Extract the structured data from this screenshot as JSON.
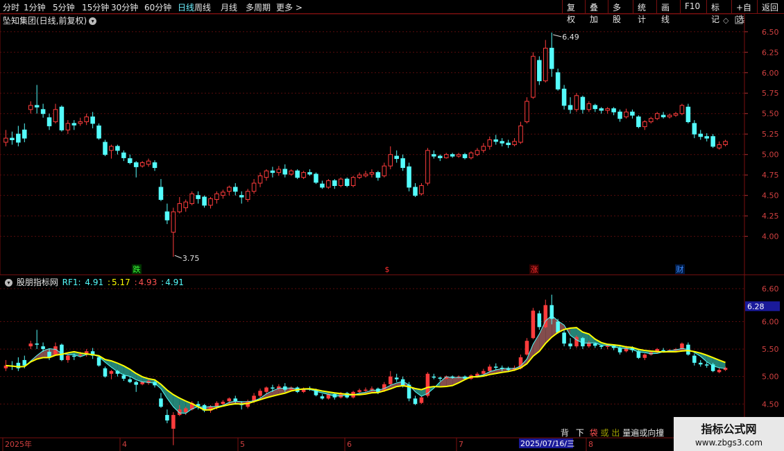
{
  "toolbar": {
    "periods": [
      "分时",
      "1分钟",
      "5分钟",
      "15分钟",
      "30分钟",
      "60分钟",
      "日线",
      "周线",
      "月线",
      "多周期",
      "更多 >"
    ],
    "active_period": "日线",
    "right_buttons": [
      "复权",
      "叠加",
      "多股",
      "统计",
      "画线",
      "F10",
      "标记",
      "+自选",
      "返回"
    ]
  },
  "main_title": "坠知集团(日线,前复权)",
  "price_axis": [
    "6.50",
    "6.25",
    "6.00",
    "5.75",
    "5.50",
    "5.25",
    "5.00",
    "4.75",
    "4.50",
    "4.25",
    "4.00"
  ],
  "high_label": "6.49",
  "low_label": "3.75",
  "event_markers": [
    "跌",
    "$",
    "涨",
    "财"
  ],
  "indicator": {
    "name": "股朋指标网",
    "rf1_label": "RF1:",
    "values": [
      "4.91",
      "5.17",
      "4.93",
      "4.91"
    ],
    "axis": [
      "6.60",
      "6.00",
      "5.50",
      "5.00",
      "4.50"
    ],
    "current_price_tag": "6.28"
  },
  "date_axis": {
    "labels": [
      "2025年",
      "4",
      "5",
      "6",
      "7",
      "8"
    ],
    "cursor_date": "2025/07/16/三"
  },
  "bottom_annotations": [
    "背",
    "下",
    "袋",
    "或",
    "出"
  ],
  "overlap_text": "量遍或向撞",
  "watermark": {
    "line1": "指标公式网",
    "line2": "www.zbgs3.com"
  },
  "colors": {
    "up": "#ff3c3c",
    "down": "#54fcfc",
    "grid": "#5a0c0c",
    "ma": "#ffff00",
    "cloud": "#2a9a8a",
    "cloud_red": "#9a5a5a"
  },
  "chart_data": {
    "type": "candlestick",
    "ylim": [
      3.7,
      6.6
    ],
    "candles": [
      [
        5.15,
        5.2,
        5.1,
        5.3
      ],
      [
        5.2,
        5.18,
        5.12,
        5.28
      ],
      [
        5.25,
        5.15,
        5.1,
        5.35
      ],
      [
        5.3,
        5.2,
        5.15,
        5.38
      ],
      [
        5.55,
        5.6,
        5.5,
        5.65
      ],
      [
        5.6,
        5.58,
        5.5,
        5.85
      ],
      [
        5.55,
        5.5,
        5.45,
        5.62
      ],
      [
        5.45,
        5.35,
        5.3,
        5.5
      ],
      [
        5.4,
        5.55,
        5.38,
        5.62
      ],
      [
        5.58,
        5.3,
        5.28,
        5.6
      ],
      [
        5.3,
        5.38,
        5.25,
        5.42
      ],
      [
        5.38,
        5.36,
        5.3,
        5.42
      ],
      [
        5.38,
        5.4,
        5.35,
        5.45
      ],
      [
        5.4,
        5.46,
        5.36,
        5.5
      ],
      [
        5.46,
        5.38,
        5.32,
        5.52
      ],
      [
        5.35,
        5.2,
        5.18,
        5.38
      ],
      [
        5.15,
        5.0,
        4.98,
        5.18
      ],
      [
        5.05,
        5.1,
        4.95,
        5.12
      ],
      [
        5.1,
        5.05,
        5.0,
        5.12
      ],
      [
        5.02,
        4.96,
        4.92,
        5.05
      ],
      [
        4.95,
        4.9,
        4.88,
        5.0
      ],
      [
        4.9,
        4.85,
        4.72,
        4.92
      ],
      [
        4.86,
        4.9,
        4.84,
        4.92
      ],
      [
        4.88,
        4.92,
        4.85,
        4.95
      ],
      [
        4.9,
        4.84,
        4.8,
        4.93
      ],
      [
        4.6,
        4.45,
        4.43,
        4.7
      ],
      [
        4.3,
        4.2,
        4.15,
        4.4
      ],
      [
        4.05,
        4.3,
        3.75,
        4.35
      ],
      [
        4.3,
        4.4,
        4.28,
        4.48
      ],
      [
        4.35,
        4.42,
        4.3,
        4.45
      ],
      [
        4.4,
        4.52,
        4.38,
        4.55
      ],
      [
        4.5,
        4.46,
        4.4,
        4.55
      ],
      [
        4.48,
        4.38,
        4.35,
        4.5
      ],
      [
        4.38,
        4.46,
        4.34,
        4.48
      ],
      [
        4.45,
        4.52,
        4.4,
        4.55
      ],
      [
        4.5,
        4.54,
        4.46,
        4.57
      ],
      [
        4.55,
        4.6,
        4.5,
        4.62
      ],
      [
        4.6,
        4.55,
        4.5,
        4.65
      ],
      [
        4.5,
        4.48,
        4.4,
        4.55
      ],
      [
        4.45,
        4.55,
        4.42,
        4.58
      ],
      [
        4.55,
        4.65,
        4.52,
        4.7
      ],
      [
        4.65,
        4.74,
        4.6,
        4.78
      ],
      [
        4.72,
        4.8,
        4.68,
        4.82
      ],
      [
        4.8,
        4.78,
        4.72,
        4.85
      ],
      [
        4.78,
        4.82,
        4.74,
        4.86
      ],
      [
        4.82,
        4.76,
        4.72,
        4.88
      ],
      [
        4.76,
        4.8,
        4.74,
        4.82
      ],
      [
        4.8,
        4.72,
        4.7,
        4.82
      ],
      [
        4.72,
        4.78,
        4.7,
        4.8
      ],
      [
        4.78,
        4.76,
        4.74,
        4.82
      ],
      [
        4.76,
        4.66,
        4.64,
        4.78
      ],
      [
        4.64,
        4.6,
        4.58,
        4.68
      ],
      [
        4.6,
        4.68,
        4.58,
        4.7
      ],
      [
        4.68,
        4.62,
        4.58,
        4.7
      ],
      [
        4.62,
        4.7,
        4.6,
        4.72
      ],
      [
        4.7,
        4.62,
        4.6,
        4.72
      ],
      [
        4.62,
        4.72,
        4.6,
        4.74
      ],
      [
        4.72,
        4.75,
        4.7,
        4.78
      ],
      [
        4.74,
        4.76,
        4.72,
        4.8
      ],
      [
        4.76,
        4.78,
        4.72,
        4.82
      ],
      [
        4.78,
        4.72,
        4.68,
        4.8
      ],
      [
        4.74,
        4.86,
        4.72,
        4.9
      ],
      [
        4.86,
        5.0,
        4.82,
        5.1
      ],
      [
        4.98,
        4.95,
        4.9,
        5.05
      ],
      [
        4.95,
        4.84,
        4.8,
        5.0
      ],
      [
        4.85,
        4.6,
        4.55,
        4.9
      ],
      [
        4.6,
        4.5,
        4.48,
        4.65
      ],
      [
        4.52,
        4.62,
        4.5,
        4.65
      ],
      [
        4.65,
        5.05,
        4.62,
        5.08
      ],
      [
        5.0,
        4.98,
        4.95,
        5.05
      ],
      [
        4.98,
        4.96,
        4.92,
        5.0
      ],
      [
        4.96,
        5.0,
        4.95,
        5.02
      ],
      [
        5.0,
        4.98,
        4.96,
        5.02
      ],
      [
        4.98,
        5.0,
        4.96,
        5.02
      ],
      [
        5.0,
        4.96,
        4.94,
        5.02
      ],
      [
        4.96,
        5.02,
        4.94,
        5.04
      ],
      [
        5.0,
        5.05,
        4.98,
        5.08
      ],
      [
        5.05,
        5.1,
        5.02,
        5.14
      ],
      [
        5.1,
        5.18,
        5.06,
        5.22
      ],
      [
        5.18,
        5.16,
        5.12,
        5.24
      ],
      [
        5.16,
        5.14,
        5.1,
        5.2
      ],
      [
        5.14,
        5.12,
        5.08,
        5.18
      ],
      [
        5.12,
        5.16,
        5.1,
        5.2
      ],
      [
        5.15,
        5.35,
        5.13,
        5.4
      ],
      [
        5.4,
        5.65,
        5.38,
        5.7
      ],
      [
        5.7,
        6.2,
        5.68,
        6.25
      ],
      [
        6.15,
        5.9,
        5.85,
        6.2
      ],
      [
        5.9,
        6.3,
        5.88,
        6.4
      ],
      [
        6.3,
        6.05,
        5.95,
        6.49
      ],
      [
        6.0,
        5.8,
        5.78,
        6.05
      ],
      [
        5.8,
        5.6,
        5.55,
        5.85
      ],
      [
        5.6,
        5.55,
        5.5,
        5.7
      ],
      [
        5.55,
        5.72,
        5.52,
        5.75
      ],
      [
        5.7,
        5.55,
        5.5,
        5.72
      ],
      [
        5.55,
        5.62,
        5.52,
        5.65
      ],
      [
        5.6,
        5.56,
        5.52,
        5.62
      ],
      [
        5.56,
        5.54,
        5.5,
        5.58
      ],
      [
        5.54,
        5.56,
        5.5,
        5.58
      ],
      [
        5.56,
        5.52,
        5.48,
        5.58
      ],
      [
        5.52,
        5.44,
        5.4,
        5.55
      ],
      [
        5.46,
        5.52,
        5.44,
        5.56
      ],
      [
        5.52,
        5.48,
        5.44,
        5.55
      ],
      [
        5.46,
        5.34,
        5.32,
        5.48
      ],
      [
        5.34,
        5.4,
        5.3,
        5.42
      ],
      [
        5.4,
        5.44,
        5.38,
        5.46
      ],
      [
        5.44,
        5.5,
        5.42,
        5.52
      ],
      [
        5.48,
        5.46,
        5.44,
        5.52
      ],
      [
        5.46,
        5.48,
        5.44,
        5.5
      ],
      [
        5.48,
        5.5,
        5.46,
        5.52
      ],
      [
        5.5,
        5.6,
        5.48,
        5.62
      ],
      [
        5.58,
        5.4,
        5.38,
        5.62
      ],
      [
        5.38,
        5.25,
        5.2,
        5.42
      ],
      [
        5.25,
        5.22,
        5.18,
        5.3
      ],
      [
        5.22,
        5.2,
        5.16,
        5.26
      ],
      [
        5.22,
        5.1,
        5.08,
        5.25
      ],
      [
        5.08,
        5.12,
        5.06,
        5.16
      ],
      [
        5.12,
        5.16,
        5.1,
        5.18
      ]
    ]
  }
}
